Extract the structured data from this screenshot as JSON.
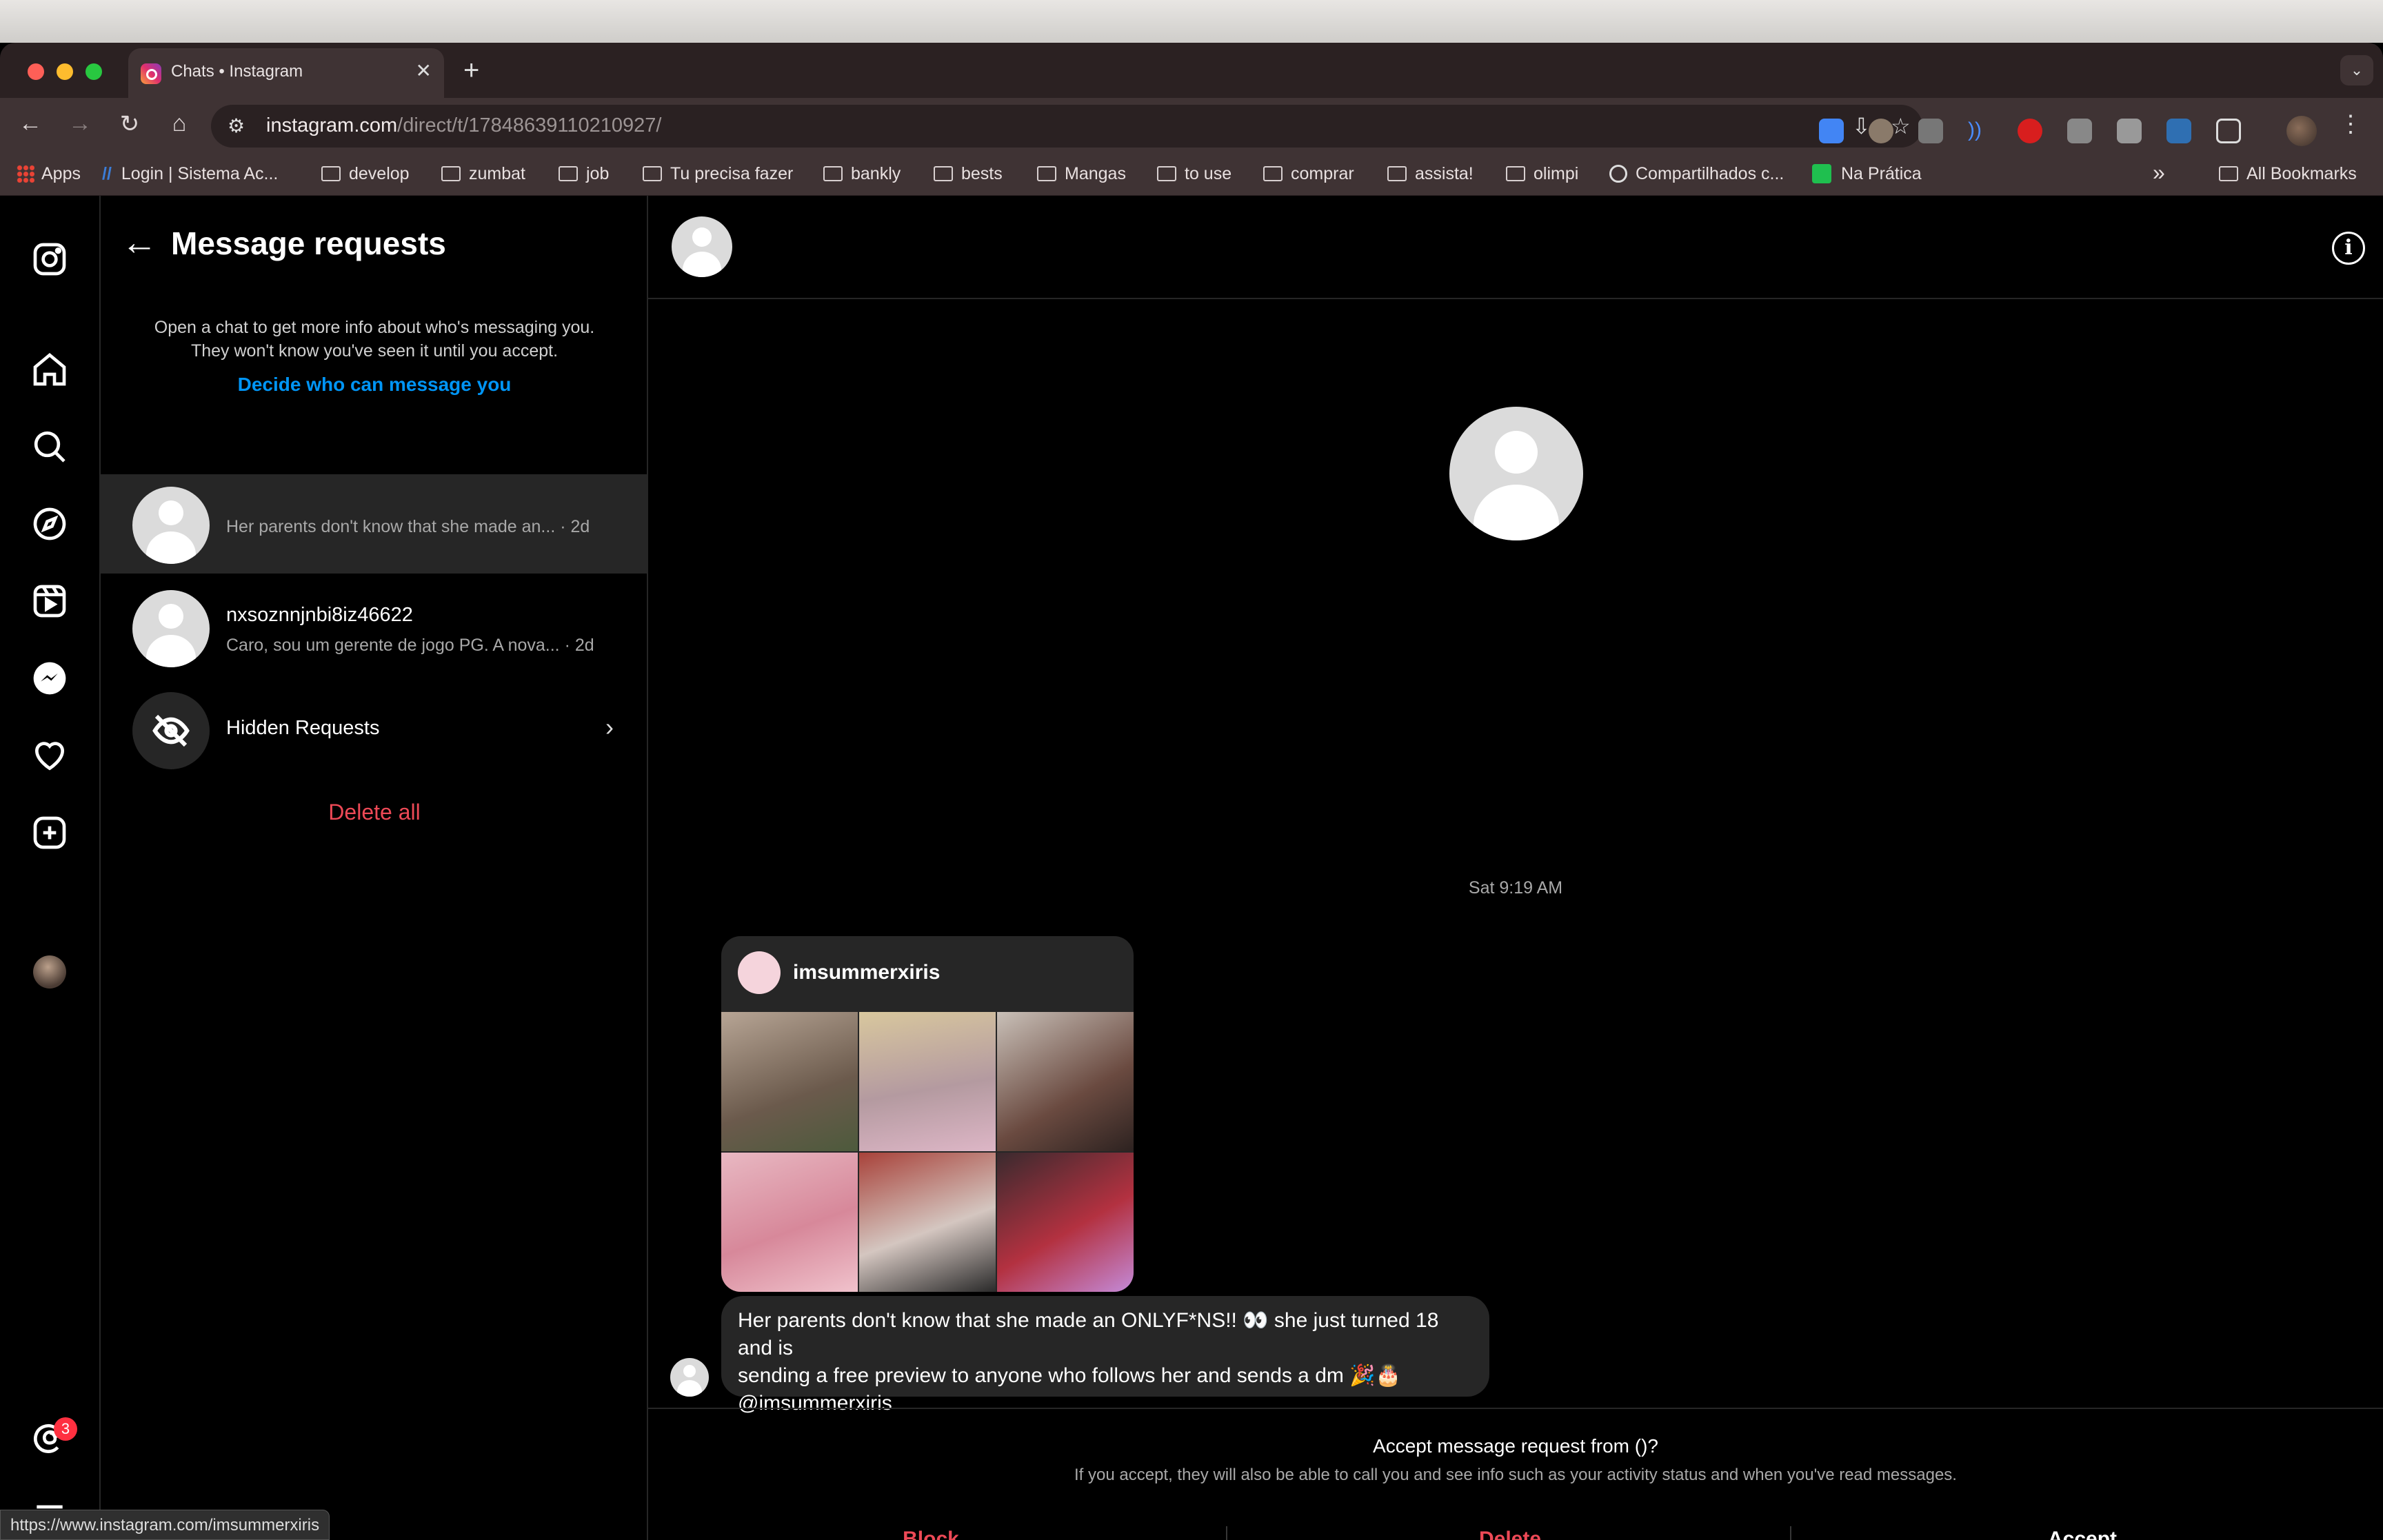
{
  "browser": {
    "tab_title": "Chats • Instagram",
    "tab_close": "✕",
    "new_tab": "+",
    "url_host": "instagram.com",
    "url_path": "/direct/t/17848639110210927/",
    "bookmarks": [
      {
        "label": "Apps",
        "type": "apps"
      },
      {
        "label": "Login | Sistema Ac...",
        "type": "link"
      },
      {
        "label": "develop",
        "type": "folder"
      },
      {
        "label": "zumbat",
        "type": "folder"
      },
      {
        "label": "job",
        "type": "folder"
      },
      {
        "label": "Tu precisa fazer",
        "type": "folder"
      },
      {
        "label": "bankly",
        "type": "folder"
      },
      {
        "label": "bests",
        "type": "folder"
      },
      {
        "label": "Mangas",
        "type": "folder"
      },
      {
        "label": "to use",
        "type": "folder"
      },
      {
        "label": "comprar",
        "type": "folder"
      },
      {
        "label": "assista!",
        "type": "folder"
      },
      {
        "label": "olimpi",
        "type": "folder"
      },
      {
        "label": "Compartilhados c...",
        "type": "link"
      },
      {
        "label": "Na Prática",
        "type": "link"
      }
    ],
    "bookmarks_overflow": "»",
    "all_bookmarks": "All Bookmarks",
    "status_url": "https://www.instagram.com/imsummerxiris"
  },
  "sidebar": {
    "notification_count": "3"
  },
  "requests_panel": {
    "title": "Message requests",
    "info_line1": "Open a chat to get more info about who's messaging you.",
    "info_line2": "They won't know you've seen it until you accept.",
    "decide_link": "Decide who can message you",
    "items": [
      {
        "name": "",
        "preview": "Her parents don't know that she made an...",
        "time": "· 2d"
      },
      {
        "name": "nxsoznnjnbi8iz46622",
        "preview": "Caro, sou um gerente de jogo PG. A nova...",
        "time": "· 2d"
      }
    ],
    "hidden_requests": "Hidden Requests",
    "delete_all": "Delete all"
  },
  "chat": {
    "timestamp": "Sat 9:19 AM",
    "shared_username": "imsummerxiris",
    "message_line1": "Her parents don't know that she made an ONLYF*NS!! 👀 she just turned 18 and is",
    "message_line2": "sending a free preview to anyone who follows her and sends a dm 🎉🎂",
    "message_line3": "@imsummerxiris",
    "accept_question": "Accept message request from ()?",
    "accept_note": "If you accept, they will also be able to call you and see info such as your activity status and when you've read messages.",
    "block": "Block",
    "delete": "Delete",
    "accept": "Accept"
  },
  "colors": {
    "accent_blue": "#0095f6",
    "danger_red": "#ed4956",
    "badge_red": "#ff3040"
  }
}
